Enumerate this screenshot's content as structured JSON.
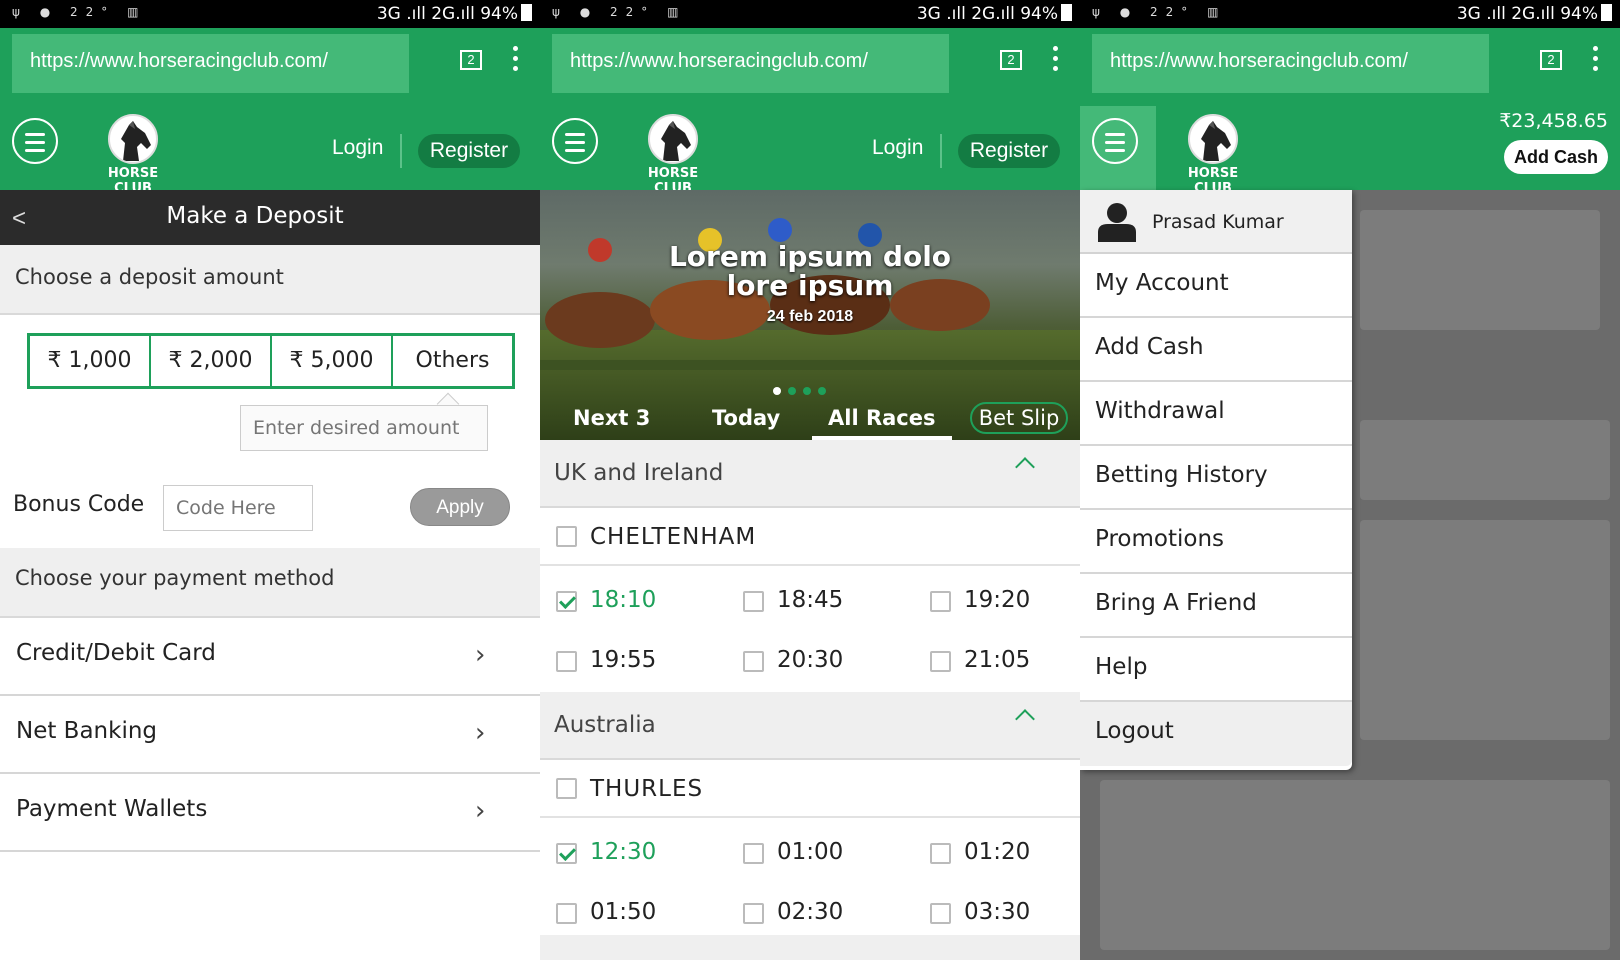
{
  "status_bar": {
    "left_icons": [
      "usb-icon",
      "bulb-icon",
      "temperature-icon",
      "barcode-icon"
    ],
    "temperature": "22°",
    "network": "3G .ıll 2G.ıll",
    "battery": "94%"
  },
  "browser": {
    "url": "https://www.horseracingclub.com/",
    "tab_count": "2"
  },
  "header": {
    "logo_text": "HORSE CLUB",
    "login": "Login",
    "register": "Register",
    "balance": "₹23,458.65",
    "add_cash": "Add Cash"
  },
  "deposit": {
    "title": "Make a Deposit",
    "choose_amount": "Choose a deposit amount",
    "amounts": [
      "₹ 1,000",
      "₹ 2,000",
      "₹ 5,000",
      "Others"
    ],
    "amount_placeholder": "Enter desired amount",
    "bonus_label": "Bonus Code",
    "bonus_placeholder": "Code Here",
    "apply": "Apply",
    "choose_method": "Choose your payment method",
    "methods": [
      "Credit/Debit Card",
      "Net Banking",
      "Payment Wallets"
    ]
  },
  "races": {
    "hero_title_line1": "Lorem ipsum dolo",
    "hero_title_line2": "lore ipsum",
    "hero_date": "24 feb 2018",
    "carousel_active_index": 0,
    "carousel_count": 4,
    "tabs": [
      "Next 3",
      "Today",
      "All Races",
      "Bet Slip"
    ],
    "active_tab": "All Races",
    "bet_slip_count": "2",
    "regions": [
      {
        "name": "UK and Ireland",
        "venue": "CHELTENHAM",
        "times": [
          {
            "t": "18:10",
            "checked": true
          },
          {
            "t": "18:45",
            "checked": false
          },
          {
            "t": "19:20",
            "checked": false
          },
          {
            "t": "19:55",
            "checked": false
          },
          {
            "t": "20:30",
            "checked": false
          },
          {
            "t": "21:05",
            "checked": false
          }
        ]
      },
      {
        "name": "Australia",
        "venue": "THURLES",
        "times": [
          {
            "t": "12:30",
            "checked": true
          },
          {
            "t": "01:00",
            "checked": false
          },
          {
            "t": "01:20",
            "checked": false
          },
          {
            "t": "01:50",
            "checked": false
          },
          {
            "t": "02:30",
            "checked": false
          },
          {
            "t": "03:30",
            "checked": false
          }
        ]
      }
    ]
  },
  "menu": {
    "user_name": "Prasad Kumar",
    "items": [
      "My Account",
      "Add Cash",
      "Withdrawal",
      "Betting History",
      "Promotions",
      "Bring A Friend",
      "Help",
      "Logout"
    ]
  },
  "colors": {
    "brand_green": "#1ea05a",
    "dark_header": "#2b2b2b",
    "badge_red": "#e01b1b"
  }
}
